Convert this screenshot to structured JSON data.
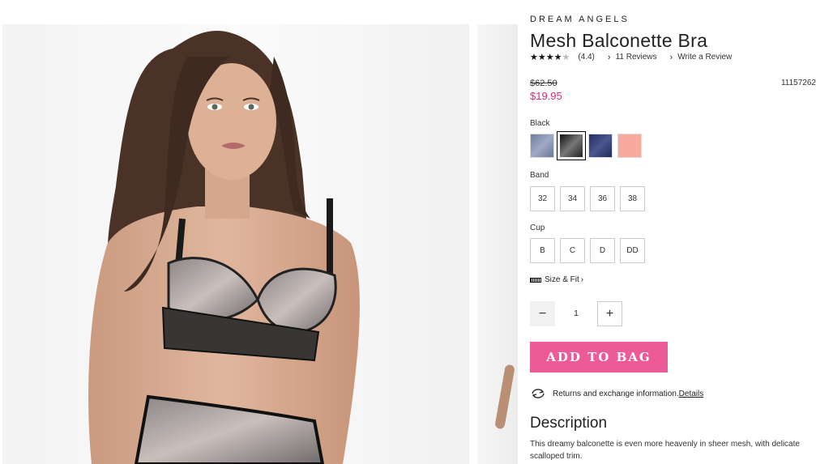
{
  "product": {
    "brand": "DREAM ANGELS",
    "title": "Mesh Balconette Bra",
    "rating": "(4.4)",
    "rating_value": 4.4,
    "reviews_link": "11 Reviews",
    "write_review_link": "Write a Review",
    "price_original": "$62.50",
    "price_sale": "$19.95",
    "sku": "11157262",
    "color_label": "Black",
    "swatches": [
      {
        "name": "blue-grey",
        "color": "#7e8aa8"
      },
      {
        "name": "black",
        "color": "#2a2a2a",
        "selected": true
      },
      {
        "name": "navy",
        "color": "#2e3a6a"
      },
      {
        "name": "peach",
        "color": "#f9aa9e"
      }
    ],
    "band_label": "Band",
    "band_sizes": [
      "32",
      "34",
      "36",
      "38"
    ],
    "cup_label": "Cup",
    "cup_sizes": [
      "B",
      "C",
      "D",
      "DD"
    ],
    "size_fit_label": "Size & Fit",
    "quantity": "1",
    "add_to_bag_label": "ADD TO BAG",
    "returns_text": "Returns and exchange information.",
    "returns_link": "Details",
    "description_title": "Description",
    "description_text": "This dreamy balconette is even more heavenly in sheer mesh, with delicate scalloped trim."
  },
  "colors": {
    "accent_pink": "#ec5a97",
    "sale_price": "#d6297a"
  }
}
